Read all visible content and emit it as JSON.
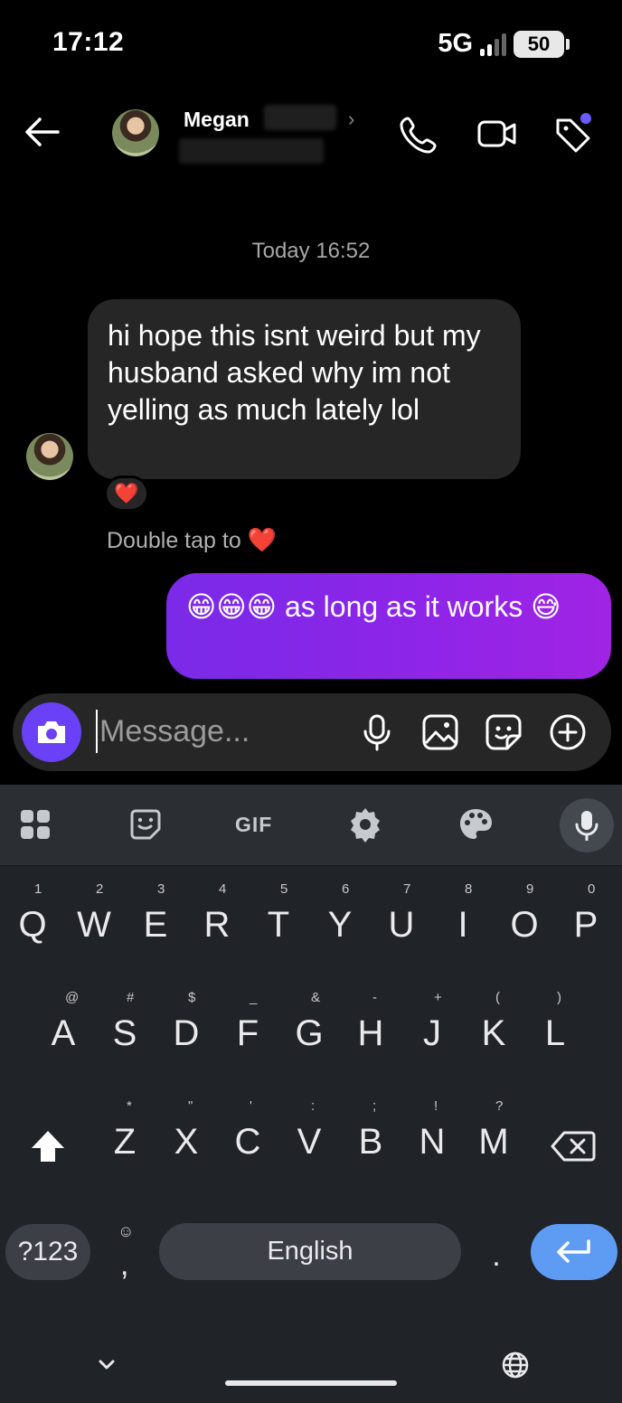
{
  "status_bar": {
    "time": "17:12",
    "network": "5G",
    "battery": "50"
  },
  "header": {
    "contact_name": "Megan"
  },
  "chat": {
    "timestamp": "Today 16:52",
    "incoming_message": "hi hope this isnt weird but my husband asked why im not yelling as much lately lol",
    "reaction": "❤️",
    "double_tap_text": "Double tap to",
    "double_tap_emoji": "❤️",
    "outgoing_message": "😁😁😁 as long as it works 😅"
  },
  "composer": {
    "placeholder": "Message..."
  },
  "keyboard": {
    "toolbar_gif": "GIF",
    "row1": [
      {
        "key": "Q",
        "hint": "1"
      },
      {
        "key": "W",
        "hint": "2"
      },
      {
        "key": "E",
        "hint": "3"
      },
      {
        "key": "R",
        "hint": "4"
      },
      {
        "key": "T",
        "hint": "5"
      },
      {
        "key": "Y",
        "hint": "6"
      },
      {
        "key": "U",
        "hint": "7"
      },
      {
        "key": "I",
        "hint": "8"
      },
      {
        "key": "O",
        "hint": "9"
      },
      {
        "key": "P",
        "hint": "0"
      }
    ],
    "row2": [
      {
        "key": "A",
        "hint": "@"
      },
      {
        "key": "S",
        "hint": "#"
      },
      {
        "key": "D",
        "hint": "$"
      },
      {
        "key": "F",
        "hint": "_"
      },
      {
        "key": "G",
        "hint": "&"
      },
      {
        "key": "H",
        "hint": "-"
      },
      {
        "key": "J",
        "hint": "+"
      },
      {
        "key": "K",
        "hint": "("
      },
      {
        "key": "L",
        "hint": ")"
      }
    ],
    "row3": [
      {
        "key": "Z",
        "hint": "*"
      },
      {
        "key": "X",
        "hint": "\""
      },
      {
        "key": "C",
        "hint": "'"
      },
      {
        "key": "V",
        "hint": ":"
      },
      {
        "key": "B",
        "hint": ";"
      },
      {
        "key": "N",
        "hint": "!"
      },
      {
        "key": "M",
        "hint": "?"
      }
    ],
    "symbols_label": "?123",
    "comma": ",",
    "space_label": "English",
    "period": "."
  }
}
